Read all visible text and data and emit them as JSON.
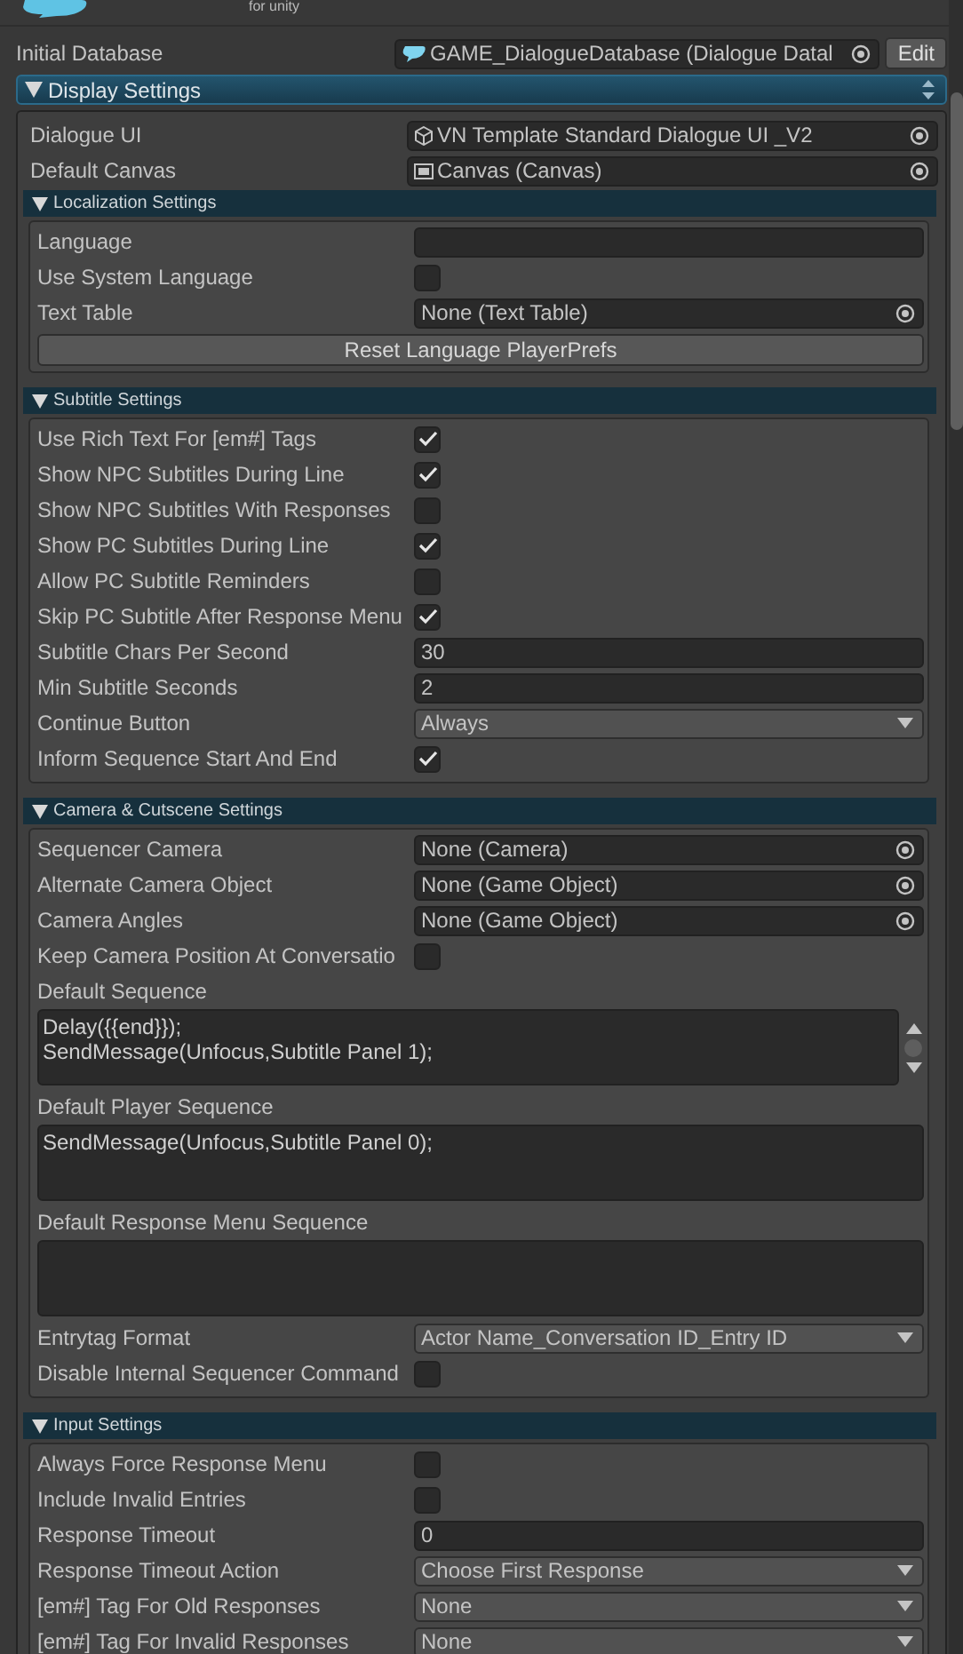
{
  "header": {
    "subtitle": "for unity"
  },
  "initial_database": {
    "label": "Initial Database",
    "value": "GAME_DialogueDatabase (Dialogue Datal",
    "button": "Edit"
  },
  "display_settings": {
    "title": "Display Settings",
    "expanded": true,
    "fields": [
      {
        "kind": "object",
        "label": "Dialogue UI",
        "value": "VN Template Standard Dialogue UI _V2"
      },
      {
        "kind": "object",
        "label": "Default Canvas",
        "value": "Canvas (Canvas)"
      }
    ],
    "sections": [
      {
        "title": "Localization Settings",
        "expanded": true,
        "rows": [
          {
            "kind": "text",
            "label": "Language",
            "value": ""
          },
          {
            "kind": "checkbox",
            "label": "Use System Language",
            "checked": false
          },
          {
            "kind": "object",
            "label": "Text Table",
            "value": "None (Text Table)"
          },
          {
            "kind": "button",
            "label": "Reset Language PlayerPrefs"
          }
        ]
      },
      {
        "title": "Subtitle Settings",
        "expanded": true,
        "rows": [
          {
            "kind": "checkbox",
            "label": "Use Rich Text For [em#] Tags",
            "checked": true
          },
          {
            "kind": "checkbox",
            "label": "Show NPC Subtitles During Line",
            "checked": true
          },
          {
            "kind": "checkbox",
            "label": "Show NPC Subtitles With Responses",
            "checked": false
          },
          {
            "kind": "checkbox",
            "label": "Show PC Subtitles During Line",
            "checked": true
          },
          {
            "kind": "checkbox",
            "label": "Allow PC Subtitle Reminders",
            "checked": false
          },
          {
            "kind": "checkbox",
            "label": "Skip PC Subtitle After Response Menu",
            "checked": true
          },
          {
            "kind": "text",
            "label": "Subtitle Chars Per Second",
            "value": "30"
          },
          {
            "kind": "text",
            "label": "Min Subtitle Seconds",
            "value": "2"
          },
          {
            "kind": "dropdown",
            "label": "Continue Button",
            "value": "Always"
          },
          {
            "kind": "checkbox",
            "label": "Inform Sequence Start And End",
            "checked": true
          }
        ]
      },
      {
        "title": "Camera & Cutscene Settings",
        "expanded": true,
        "rows": [
          {
            "kind": "object",
            "label": "Sequencer Camera",
            "value": "None (Camera)"
          },
          {
            "kind": "object",
            "label": "Alternate Camera Object",
            "value": "None (Game Object)"
          },
          {
            "kind": "object",
            "label": "Camera Angles",
            "value": "None (Game Object)"
          },
          {
            "kind": "checkbox",
            "label": "Keep Camera Position At Conversatio",
            "checked": false
          },
          {
            "kind": "textarea",
            "label": "Default Sequence",
            "lines": [
              "Delay({{end}});",
              "SendMessage(Unfocus,Subtitle Panel 1);"
            ],
            "scrollbar": true
          },
          {
            "kind": "textarea",
            "label": "Default Player Sequence",
            "lines": [
              "SendMessage(Unfocus,Subtitle Panel 0);"
            ],
            "scrollbar": false
          },
          {
            "kind": "textarea",
            "label": "Default Response Menu Sequence",
            "lines": [],
            "scrollbar": false
          },
          {
            "kind": "dropdown",
            "label": "Entrytag Format",
            "value": "Actor Name_Conversation ID_Entry ID"
          },
          {
            "kind": "checkbox",
            "label": "Disable Internal Sequencer Command",
            "checked": false
          }
        ]
      },
      {
        "title": "Input Settings",
        "expanded": true,
        "rows": [
          {
            "kind": "checkbox",
            "label": "Always Force Response Menu",
            "checked": false
          },
          {
            "kind": "checkbox",
            "label": "Include Invalid Entries",
            "checked": false
          },
          {
            "kind": "text",
            "label": "Response Timeout",
            "value": "0"
          },
          {
            "kind": "dropdown",
            "label": "Response Timeout Action",
            "value": "Choose First Response"
          },
          {
            "kind": "dropdown",
            "label": "[em#] Tag For Old Responses",
            "value": "None"
          },
          {
            "kind": "dropdown",
            "label": "[em#] Tag For Invalid Responses",
            "value": "None"
          }
        ]
      }
    ]
  }
}
